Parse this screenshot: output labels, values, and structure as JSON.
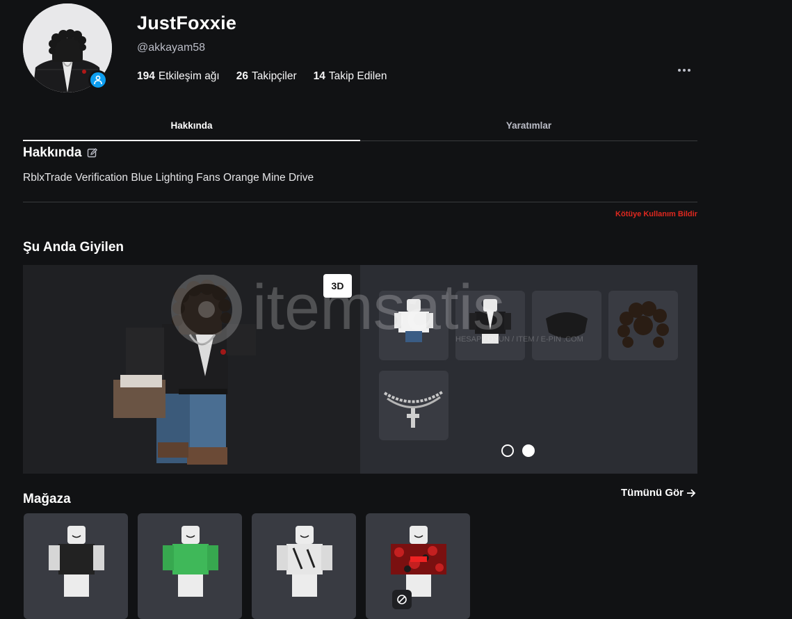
{
  "profile": {
    "display_name": "JustFoxxie",
    "username": "@akkayam58",
    "avatar_icon": "avatar-headshot",
    "verified_icon": "person-badge-icon"
  },
  "stats": [
    {
      "count": "194",
      "label": "Etkileşim ağı"
    },
    {
      "count": "26",
      "label": "Takipçiler"
    },
    {
      "count": "14",
      "label": "Takip Edilen"
    }
  ],
  "tabs": [
    {
      "label": "Hakkında",
      "active": true
    },
    {
      "label": "Yaratımlar",
      "active": false
    }
  ],
  "about": {
    "title": "Hakkında",
    "text": "RblxTrade Verification Blue Lighting Fans Orange Mine Drive",
    "report_label": "Kötüye Kullanım Bildir"
  },
  "wearing": {
    "title": "Şu Anda Giyilen",
    "view_toggle_label": "3D",
    "items": [
      "shirt-white",
      "jacket-black",
      "mask-black",
      "hair-dreadlocks",
      "chain-cross"
    ],
    "pages": 2,
    "current_page": 2
  },
  "watermark": {
    "brand": "itemsatis",
    "tagline": "HESAP / OYUN / ITEM / E-PIN .COM"
  },
  "store": {
    "title": "Mağaza",
    "see_all_label": "Tümünü Gör",
    "items": [
      "varsity-jacket",
      "green-hoodie",
      "white-graphic-shirt",
      "red-camo-supreme"
    ]
  },
  "colors": {
    "background": "#111214",
    "panel": "#2b2d33",
    "tile": "#393b42",
    "accent_blue": "#0d9ef0",
    "report_red": "#e0281f"
  }
}
